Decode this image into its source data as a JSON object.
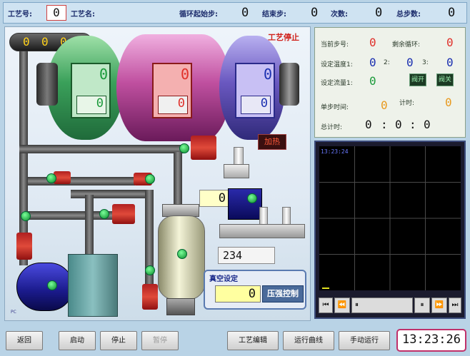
{
  "topbar": {
    "process_no_label": "工艺号:",
    "process_no_value": "0",
    "process_name_label": "工艺名:",
    "loop_start_label": "循环起始步:",
    "loop_start_value": "0",
    "end_step_label": "结束步:",
    "end_step_value": "0",
    "count_label": "次数:",
    "count_value": "0",
    "total_steps_label": "总步数:",
    "total_steps_value": "0"
  },
  "process": {
    "indicator_digits": [
      "0",
      "0",
      "0",
      "0"
    ],
    "status_text": "工艺停止",
    "drum_values": [
      "0",
      "0",
      "0"
    ],
    "drum_sub_values": [
      "0",
      "0",
      "0"
    ],
    "heat_label": "加热",
    "flow_value": "0",
    "counter_value": "234",
    "vacuum_label": "真空设定",
    "vacuum_value": "0",
    "pressure_button": "压强控制",
    "corner_mark": "PC"
  },
  "info": {
    "current_step_label": "当前步号:",
    "current_step_value": "0",
    "remain_loop_label": "剩余循环:",
    "remain_loop_value": "0",
    "set_temp_label": "设定温度1:",
    "set_temp_1": "0",
    "set_temp_2_label": "2:",
    "set_temp_2": "0",
    "set_temp_3_label": "3:",
    "set_temp_3": "0",
    "set_flow_label": "设定流量1:",
    "set_flow_value": "0",
    "valve_open": "阀开",
    "valve_close": "阀关",
    "step_time_label": "单步时间:",
    "step_time_value": "0",
    "timer_label": "计时:",
    "timer_value": "0",
    "total_time_label": "总计时:",
    "total_h": "0",
    "total_m": "0",
    "total_s": "0",
    "sep": ":"
  },
  "trend": {
    "time": "13:23:24",
    "controls": [
      "⏮",
      "⏪",
      "⏸",
      "⏸",
      "⏩",
      "⏭"
    ]
  },
  "bottombar": {
    "back": "返回",
    "start": "启动",
    "stop": "停止",
    "pause": "暂停",
    "edit": "工艺编辑",
    "curve": "运行曲线",
    "manual": "手动运行",
    "clock": "13:23:26"
  }
}
